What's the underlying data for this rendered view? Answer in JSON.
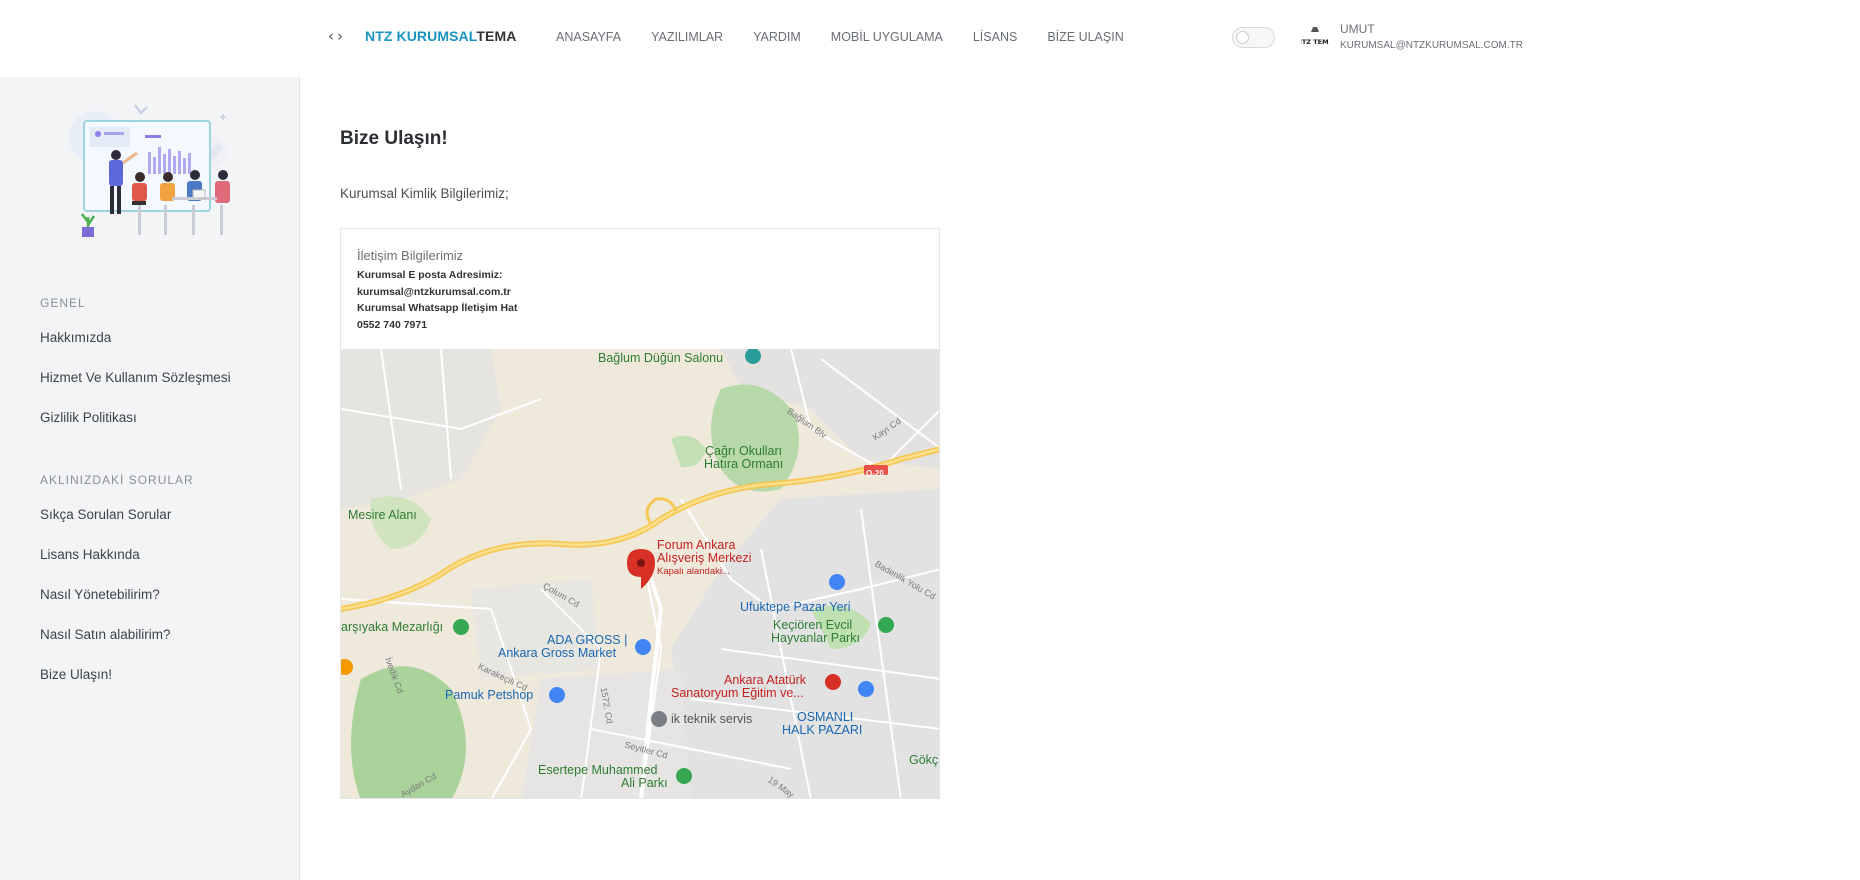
{
  "header": {
    "brand_primary": "NTZ KURUMSAL",
    "brand_secondary": "TEMA",
    "menu": [
      {
        "label": "ANASAYFA"
      },
      {
        "label": "YAZILIMLAR"
      },
      {
        "label": "YARDIM"
      },
      {
        "label": "MOBİL UYGULAMA"
      },
      {
        "label": "LİSANS"
      },
      {
        "label": "BİZE ULAŞIN"
      }
    ],
    "user_name": "UMUT",
    "user_email": "KURUMSAL@NTZKURUMSAL.COM.TR",
    "avatar_text": "NTZ TEMA"
  },
  "sidebar": {
    "section1_title": "GENEL",
    "section1_items": [
      "Hakkımızda",
      "Hizmet Ve Kullanım Sözleşmesi",
      "Gizlilik Politikası"
    ],
    "section2_title": "AKLINIZDAKİ SORULAR",
    "section2_items": [
      "Sıkça Sorulan Sorular",
      "Lisans Hakkında",
      "Nasıl Yönetebilirim?",
      "Nasıl Satın alabilirim?",
      "Bize Ulaşın!"
    ]
  },
  "main": {
    "title": "Bize Ulaşın!",
    "intro": "Kurumsal Kimlik Bilgilerimiz;",
    "card": {
      "title": "İletişim Bilgilerimiz",
      "email_label": "Kurumsal E posta Adresimiz:",
      "email": "kurumsal@ntzkurumsal.com.tr",
      "whatsapp_label": "Kurumsal Whatsapp İletişim Hat",
      "phone": "0552 740 7971"
    }
  },
  "map": {
    "labels": {
      "baglum_dugun": "Bağlum Düğün Salonu",
      "cagri_okullari": "Çağrı Okulları",
      "hatira_ormani": "Hatıra Ormanı",
      "mesire": "Mesire Alanı",
      "forum1": "Forum Ankara",
      "forum2": "Alışveriş Merkezi",
      "forum3": "Kapalı alandaki...",
      "ufuktepe": "Ufuktepe Pazar Yeri",
      "kecioren1": "Keçiören Evcil",
      "kecioren2": "Hayvanlar Parkı",
      "karsiyaka": "arşıyaka Mezarlığı",
      "ada_gross1": "ADA GROSS |",
      "ada_gross2": "Ankara Gross Market",
      "ataturk1": "Ankara Atatürk",
      "ataturk2": "Sanatoryum Eğitim ve...",
      "pamuk": "Pamuk Petshop",
      "ik_teknik": "ik teknik servis",
      "osmanli1": "OSMANLI",
      "osmanli2": "HALK PAZARI",
      "esertepe1": "Esertepe Muhammed",
      "esertepe2": "Ali Parkı",
      "gokc": "Gökç",
      "road_020": "O-20",
      "road_baglum": "Bağlum Blv",
      "road_kayi": "Kayı Cd",
      "road_badenlik": "Badenlik Yolu Cd",
      "road_colum": "Çolum Cd",
      "road_seyitler": "Seyitler Cd",
      "road_1572": "1572. Cd",
      "road_karakecili": "Karakeçili Cd",
      "road_ivedik": "İvedik Cd",
      "road_aydan": "Aydan Cd",
      "road_19may": "19 May"
    }
  },
  "colors": {
    "brand_blue": "#1a93c2",
    "sidebar_bg": "#f3f4f6",
    "map_pin_red": "#d93025"
  }
}
